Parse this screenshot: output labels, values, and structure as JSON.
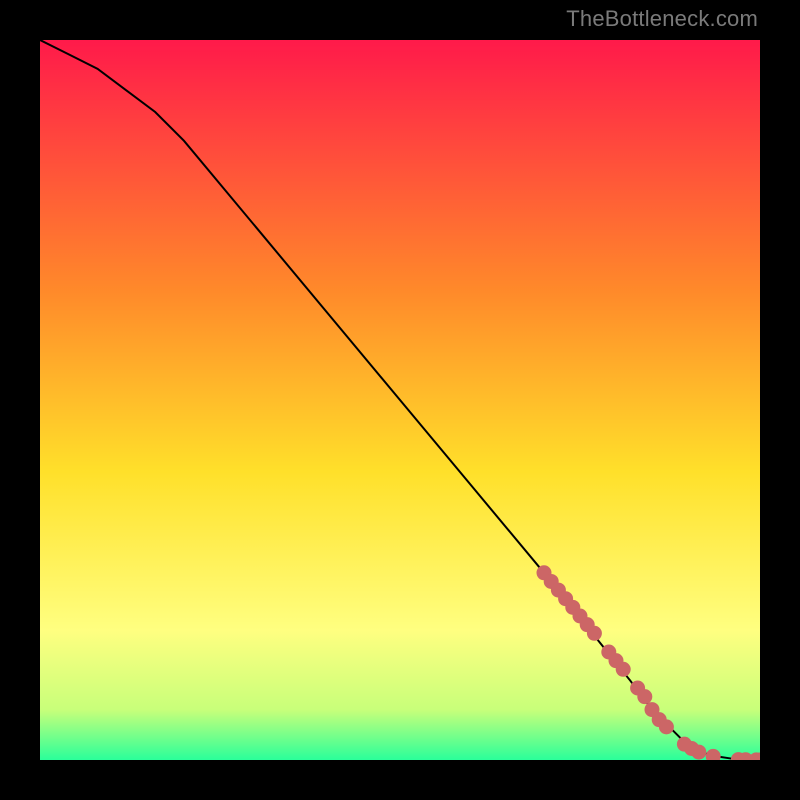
{
  "attribution": "TheBottleneck.com",
  "colors": {
    "top": "#ff1a4a",
    "mid1": "#ff8a2a",
    "mid2": "#ffe02a",
    "low1": "#ffff80",
    "low2": "#c8ff7a",
    "bottom": "#2aff9a",
    "curve": "#000000",
    "marker": "#cc6666",
    "frame": "#000000"
  },
  "chart_data": {
    "type": "line",
    "title": "",
    "xlabel": "",
    "ylabel": "",
    "xlim": [
      0,
      100
    ],
    "ylim": [
      0,
      100
    ],
    "series": [
      {
        "name": "bottleneck-curve",
        "x": [
          0,
          4,
          8,
          12,
          16,
          20,
          30,
          40,
          50,
          60,
          70,
          78,
          82,
          85,
          88,
          90,
          92,
          94,
          96,
          98,
          100
        ],
        "y": [
          100,
          98,
          96,
          93,
          90,
          86,
          74,
          62,
          50,
          38,
          26,
          16,
          11,
          7,
          4,
          2,
          1,
          0.5,
          0.2,
          0.1,
          0
        ]
      }
    ],
    "markers": {
      "name": "data-points",
      "x": [
        70,
        71,
        72,
        73,
        74,
        75,
        76,
        77,
        79,
        80,
        81,
        83,
        84,
        85,
        86,
        87,
        89.5,
        90.5,
        91.5,
        93.5,
        97,
        98,
        99.5,
        100
      ],
      "y": [
        26,
        24.8,
        23.6,
        22.4,
        21.2,
        20,
        18.8,
        17.6,
        15,
        13.8,
        12.6,
        10,
        8.8,
        7,
        5.6,
        4.6,
        2.2,
        1.6,
        1.1,
        0.5,
        0.06,
        0.04,
        0.02,
        0
      ]
    }
  }
}
